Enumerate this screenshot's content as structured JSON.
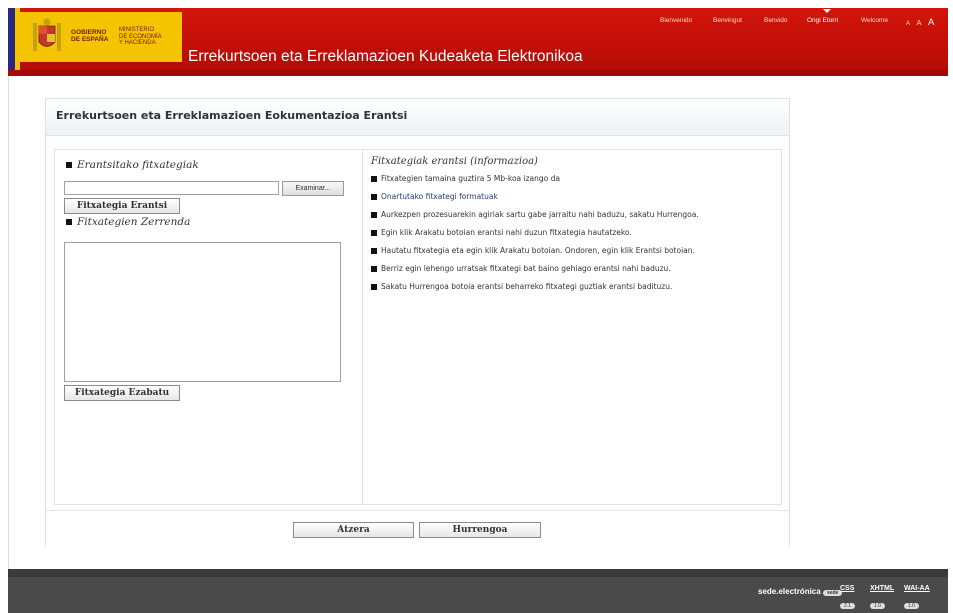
{
  "header": {
    "gov_name": [
      "GOBIERNO",
      "DE ESPAÑA"
    ],
    "ministry": [
      "MINISTERIO",
      "DE ECONOMÍA",
      "Y HACIENDA"
    ],
    "app_title": "Errekurtsoen eta Erreklamazioen Kudeaketa Elektronikoa",
    "languages": [
      "Bienvenido",
      "Benvingut",
      "Benvido",
      "Ongi Etorri",
      "Welcome"
    ],
    "active_language": "Ongi Etorri",
    "font_sizes": [
      "A",
      "A",
      "A"
    ],
    "colors": {
      "brand_red": "#c10f07",
      "logo_yellow": "#f4c400"
    }
  },
  "panel": {
    "title": "Errekurtsoen eta Erreklamazioen Eokumentazioa Erantsi",
    "left": {
      "upload_label": "Erantsitako fitxategiak",
      "file_value": "",
      "browse_label": "Examinar...",
      "attach_button": "Fitxategia Erantsi",
      "list_label": "Fitxategien Zerrenda",
      "list_items": [],
      "delete_button": "Fitxategia Ezabatu"
    },
    "right": {
      "info_title": "Fitxategiak erantsi (informazioa)",
      "items": [
        "Fitxategien tamaina guztira 5 Mb-koa izango da",
        "Onartutako fitxategi formatuak",
        "Aurkezpen prozesuarekin agiriak sartu gabe jarraitu nahi baduzu, sakatu Hurrengoa.",
        "Egin klik Arakatu botoian erantsi nahi duzun fitxategia hautatzeko.",
        "Hautatu fitxategia eta egin klik Arakatu botoian. Ondoren, egin klik Erantsi botoian.",
        "Berriz egin lehengo urratsak fitxategi bat baino gehiago erantsi nahi baduzu.",
        "Sakatu Hurrengoa botoia erantsi beharreko fitxategi guztiak erantsi badituzu."
      ]
    },
    "footer": {
      "back_button": "Atzera",
      "next_button": "Hurrengoa"
    }
  },
  "footer": {
    "sede_label": "sede.electrónica",
    "sede_sub": "sede",
    "badges": [
      {
        "name": "CSS",
        "sub": "2.1"
      },
      {
        "name": "XHTML",
        "sub": "1.0"
      },
      {
        "name": "WAI-AA",
        "sub": "1.0"
      }
    ]
  }
}
